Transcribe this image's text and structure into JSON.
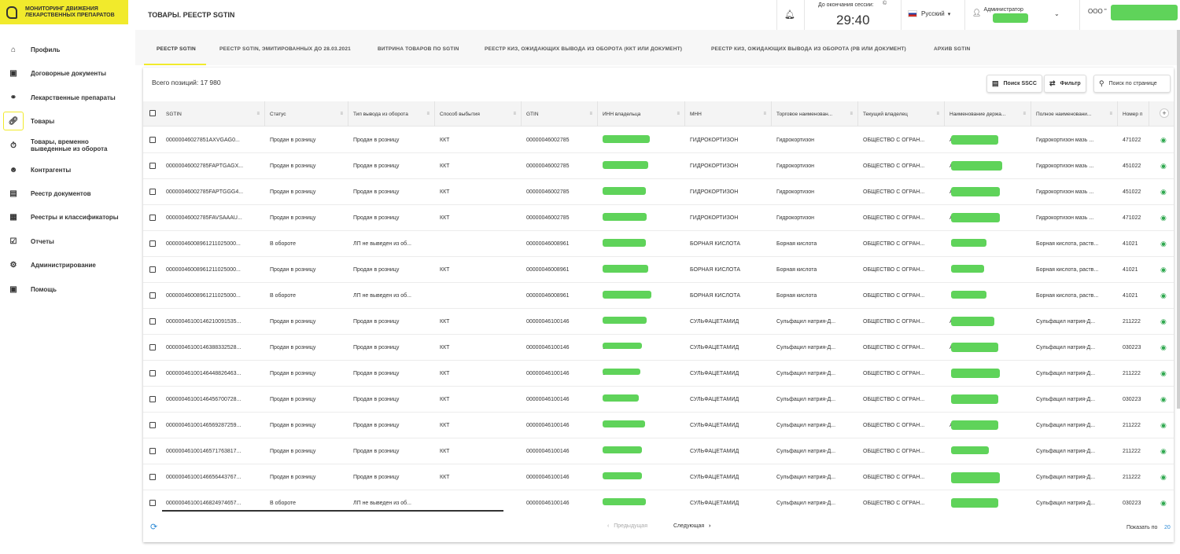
{
  "brand": {
    "line1": "МОНИТОРИНГ ДВИЖЕНИЯ",
    "line2": "ЛЕКАРСТВЕННЫХ ПРЕПАРАТОВ"
  },
  "sidebar": {
    "items": [
      {
        "label": "Профиль",
        "icon": "home-icon"
      },
      {
        "label": "Договорные документы",
        "icon": "briefcase-icon"
      },
      {
        "label": "Лекарственные препараты",
        "icon": "pills-icon"
      },
      {
        "label": "Товары",
        "icon": "link-icon",
        "active": true
      },
      {
        "label": "Товары, временно выведенные из оборота",
        "icon": "timer-icon"
      },
      {
        "label": "Контрагенты",
        "icon": "person-icon"
      },
      {
        "label": "Реестр документов",
        "icon": "document-icon"
      },
      {
        "label": "Реестры и классификаторы",
        "icon": "grid-icon"
      },
      {
        "label": "Отчеты",
        "icon": "report-icon"
      },
      {
        "label": "Администрирование",
        "icon": "gear-icon"
      },
      {
        "label": "Помощь",
        "icon": "help-icon"
      }
    ]
  },
  "header": {
    "title": "ТОВАРЫ. РЕЕСТР SGTIN",
    "session_label": "До окончания сессии:",
    "session_info": "©",
    "session_time": "29:40",
    "language": "Русский",
    "user": "Администратор",
    "org": "ООО \""
  },
  "tabs": [
    {
      "label": "РЕЕСТР SGTIN",
      "active": true
    },
    {
      "label": "РЕЕСТР SGTIN, ЭМИТИРОВАННЫХ ДО 28.03.2021"
    },
    {
      "label": "ВИТРИНА ТОВАРОВ ПО SGTIN"
    },
    {
      "label": "РЕЕСТР КИЗ, ОЖИДАЮЩИХ ВЫВОДА ИЗ ОБОРОТА (ККТ ИЛИ ДОКУМЕНТ)"
    },
    {
      "label": "РЕЕСТР КИЗ, ОЖИДАЮЩИХ ВЫВОДА ИЗ ОБОРОТА (РВ ИЛИ ДОКУМЕНТ)"
    },
    {
      "label": "АРХИВ SGTIN"
    }
  ],
  "toolbar": {
    "total": "Всего позиций: 17 980",
    "sscc_label": "Поиск SSCC",
    "filter_label": "Фильтр",
    "page_search_label": "Поиск по странице"
  },
  "table": {
    "columns": [
      "SGTIN",
      "Статус",
      "Тип вывода из оборота",
      "Способ выбытия",
      "GTIN",
      "ИНН владельца",
      "МНН",
      "Торговое наименован...",
      "Текущий владелец",
      "Наименование держа...",
      "Полное наименовани...",
      "Номер п"
    ],
    "rows": [
      {
        "sgtin": "00000046027851AXVGAG0...",
        "status": "Продан в розницу",
        "type": "Продан в розницу",
        "method": "ККТ",
        "gtin": "00000046002785",
        "inn": "",
        "mnn": "ГИДРОКОРТИЗОН",
        "trade": "Гидрокортизон",
        "owner": "ОБЩЕСТВО С ОГРАН...",
        "holder": "А",
        "full": "Гидрокортизон мазь ...",
        "num": "471022"
      },
      {
        "sgtin": "00000046002785FAPTGAGX...",
        "status": "Продан в розницу",
        "type": "Продан в розницу",
        "method": "ККТ",
        "gtin": "00000046002785",
        "inn": "9",
        "mnn": "ГИДРОКОРТИЗОН",
        "trade": "Гидрокортизон",
        "owner": "ОБЩЕСТВО С ОГРАН...",
        "holder": "А",
        "full": "Гидрокортизон мазь ...",
        "num": "451022"
      },
      {
        "sgtin": "00000046002785FAPTGGG4...",
        "status": "Продан в розницу",
        "type": "Продан в розницу",
        "method": "ККТ",
        "gtin": "00000046002785",
        "inn": "9",
        "mnn": "ГИДРОКОРТИЗОН",
        "trade": "Гидрокортизон",
        "owner": "ОБЩЕСТВО С ОГРАН...",
        "holder": "А",
        "full": "Гидрокортизон мазь ...",
        "num": "451022"
      },
      {
        "sgtin": "00000046002785FAVSAAAU...",
        "status": "Продан в розницу",
        "type": "Продан в розницу",
        "method": "ККТ",
        "gtin": "00000046002785",
        "inn": "9",
        "mnn": "ГИДРОКОРТИЗОН",
        "trade": "Гидрокортизон",
        "owner": "ОБЩЕСТВО С ОГРАН...",
        "holder": "А",
        "full": "Гидрокортизон мазь ...",
        "num": "471022"
      },
      {
        "sgtin": "00000046008961211025000...",
        "status": "В обороте",
        "type": "ЛП не выведен из об...",
        "method": "",
        "gtin": "00000046008961",
        "inn": "",
        "mnn": "БОРНАЯ КИСЛОТА",
        "trade": "Борная кислота",
        "owner": "ОБЩЕСТВО С ОГРАН...",
        "holder": "",
        "full": "Борная кислота, раств...",
        "num": "41021"
      },
      {
        "sgtin": "00000046008961211025000...",
        "status": "Продан в розницу",
        "type": "Продан в розницу",
        "method": "ККТ",
        "gtin": "00000046008961",
        "inn": "",
        "mnn": "БОРНАЯ КИСЛОТА",
        "trade": "Борная кислота",
        "owner": "ОБЩЕСТВО С ОГРАН...",
        "holder": "",
        "full": "Борная кислота, раств...",
        "num": "41021"
      },
      {
        "sgtin": "00000046008961211025000...",
        "status": "В обороте",
        "type": "ЛП не выведен из об...",
        "method": "",
        "gtin": "00000046008961",
        "inn": "",
        "mnn": "БОРНАЯ КИСЛОТА",
        "trade": "Борная кислота",
        "owner": "ОБЩЕСТВО С ОГРАН...",
        "holder": "",
        "full": "Борная кислота, раств...",
        "num": "41021"
      },
      {
        "sgtin": "00000046100146210091535...",
        "status": "Продан в розницу",
        "type": "Продан в розницу",
        "method": "ККТ",
        "gtin": "00000046100146",
        "inn": "",
        "mnn": "СУЛЬФАЦЕТАМИД",
        "trade": "Сульфацил натрия-Д...",
        "owner": "ОБЩЕСТВО С ОГРАН...",
        "holder": "А",
        "full": "Сульфацил натрия-Д...",
        "num": "211222"
      },
      {
        "sgtin": "00000046100146388332528...",
        "status": "Продан в розницу",
        "type": "Продан в розницу",
        "method": "ККТ",
        "gtin": "00000046100146",
        "inn": "9",
        "mnn": "СУЛЬФАЦЕТАМИД",
        "trade": "Сульфацил натрия-Д...",
        "owner": "ОБЩЕСТВО С ОГРАН...",
        "holder": "А",
        "full": "Сульфацил натрия-Д...",
        "num": "030223"
      },
      {
        "sgtin": "00000046100146448826463...",
        "status": "Продан в розницу",
        "type": "Продан в розницу",
        "method": "ККТ",
        "gtin": "00000046100146",
        "inn": "9",
        "mnn": "СУЛЬФАЦЕТАМИД",
        "trade": "Сульфацил натрия-Д...",
        "owner": "ОБЩЕСТВО С ОГРАН...",
        "holder": "",
        "full": "Сульфацил натрия-Д...",
        "num": "211222"
      },
      {
        "sgtin": "00000046100146456700728...",
        "status": "Продан в розницу",
        "type": "Продан в розницу",
        "method": "ККТ",
        "gtin": "00000046100146",
        "inn": "9",
        "mnn": "СУЛЬФАЦЕТАМИД",
        "trade": "Сульфацил натрия-Д...",
        "owner": "ОБЩЕСТВО С ОГРАН...",
        "holder": "",
        "full": "Сульфацил натрия-Д...",
        "num": "030223"
      },
      {
        "sgtin": "00000046100146569287259...",
        "status": "Продан в розницу",
        "type": "Продан в розницу",
        "method": "ККТ",
        "gtin": "00000046100146",
        "inn": "",
        "mnn": "СУЛЬФАЦЕТАМИД",
        "trade": "Сульфацил натрия-Д...",
        "owner": "ОБЩЕСТВО С ОГРАН...",
        "holder": "А",
        "full": "Сульфацил натрия-Д...",
        "num": "211222"
      },
      {
        "sgtin": "00000046100146571763817...",
        "status": "Продан в розницу",
        "type": "Продан в розницу",
        "method": "ККТ",
        "gtin": "00000046100146",
        "inn": "9",
        "mnn": "СУЛЬФАЦЕТАМИД",
        "trade": "Сульфацил натрия-Д...",
        "owner": "ОБЩЕСТВО С ОГРАН...",
        "holder": "",
        "full": "Сульфацил натрия-Д...",
        "num": "211222"
      },
      {
        "sgtin": "00000046100146656443767...",
        "status": "Продан в розницу",
        "type": "Продан в розницу",
        "method": "ККТ",
        "gtin": "00000046100146",
        "inn": "",
        "mnn": "СУЛЬФАЦЕТАМИД",
        "trade": "Сульфацил натрия-Д...",
        "owner": "ОБЩЕСТВО С ОГРАН...",
        "holder": "",
        "full": "Сульфацил натрия-Д...",
        "num": "211222"
      },
      {
        "sgtin": "00000046100146824974657...",
        "status": "В обороте",
        "type": "ЛП не выведен из об...",
        "method": "",
        "gtin": "00000046100146",
        "inn": "",
        "mnn": "СУЛЬФАЦЕТАМИД",
        "trade": "Сульфацил натрия-Д...",
        "owner": "ОБЩЕСТВО С ОГРАН...",
        "holder": "",
        "full": "Сульфацил натрия-Д...",
        "num": "030223"
      }
    ]
  },
  "pager": {
    "prev": "Предыдущая",
    "next": "Следующая",
    "per_page_label": "Показать по",
    "per_page_value": "20"
  },
  "colors": {
    "accent": "#f1ea2c",
    "link": "#2e8bd6",
    "eye": "#2fa84f",
    "redaction": "#5fd35a"
  }
}
